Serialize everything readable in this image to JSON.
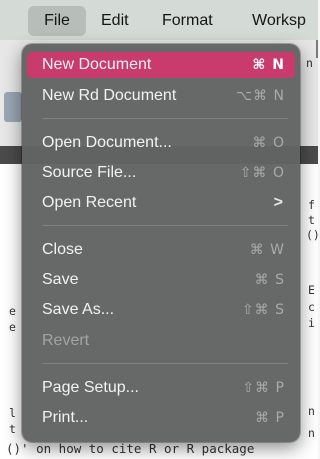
{
  "menubar": {
    "items": [
      {
        "label": "File",
        "active": true
      },
      {
        "label": "Edit"
      },
      {
        "label": "Format"
      },
      {
        "label": "Worksp"
      }
    ]
  },
  "background": {
    "right_fragments": [
      "n",
      "f",
      "t",
      "()",
      "E",
      "c",
      "i",
      "n",
      "n"
    ],
    "left_fragments": [
      "e",
      "e",
      "l",
      "t"
    ],
    "bottom_line": "()' on how to cite R or R package"
  },
  "menu": {
    "items": [
      {
        "label": "New Document",
        "shortcut": "⌘ N",
        "highlighted": true
      },
      {
        "label": "New Rd Document",
        "shortcut": "⌥⌘ N"
      },
      {
        "label": "Open Document...",
        "shortcut": "⌘ O"
      },
      {
        "label": "Source File...",
        "shortcut": "⇧⌘ O"
      },
      {
        "label": "Open Recent",
        "submenu_indicator": ">"
      },
      {
        "label": "Close",
        "shortcut": "⌘ W"
      },
      {
        "label": "Save",
        "shortcut": "⌘ S"
      },
      {
        "label": "Save As...",
        "shortcut": "⇧⌘ S"
      },
      {
        "label": "Revert",
        "disabled": true
      },
      {
        "label": "Page Setup...",
        "shortcut": "⇧⌘ P"
      },
      {
        "label": "Print...",
        "shortcut": "⌘ P"
      }
    ]
  },
  "colors": {
    "menubar_bg": "#d4dbd6",
    "menu_bg": "#626463",
    "highlight": "#c83b6c",
    "menu_text": "#f2f2f2",
    "shortcut_text": "#a9a9a9",
    "disabled_text": "#a3a3a3"
  }
}
